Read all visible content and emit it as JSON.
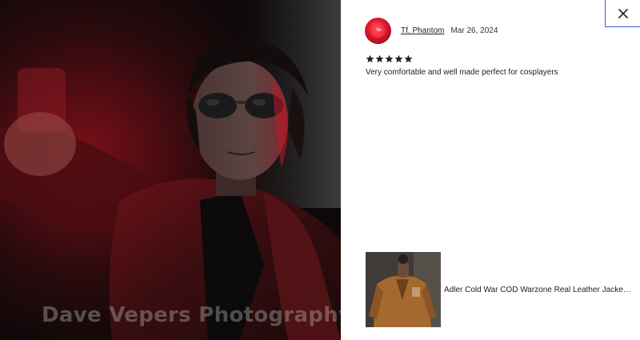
{
  "photo": {
    "watermark": "Dave Vepers Photography"
  },
  "dialog": {
    "close_label": "Close"
  },
  "review": {
    "reviewer_name": "Tf. Phantom",
    "date": "Mar 26, 2024",
    "rating": 5,
    "rating_max": 5,
    "text": "Very comfortable and well made perfect for cosplayers"
  },
  "product": {
    "title": "Adler Cold War COD Warzone Real Leather Jacket ..."
  },
  "colors": {
    "accent_border": "#3b5bdb",
    "star": "#222222",
    "photo_red": "#e0102a"
  },
  "icons": {
    "close": "close-icon",
    "star": "star-icon"
  }
}
